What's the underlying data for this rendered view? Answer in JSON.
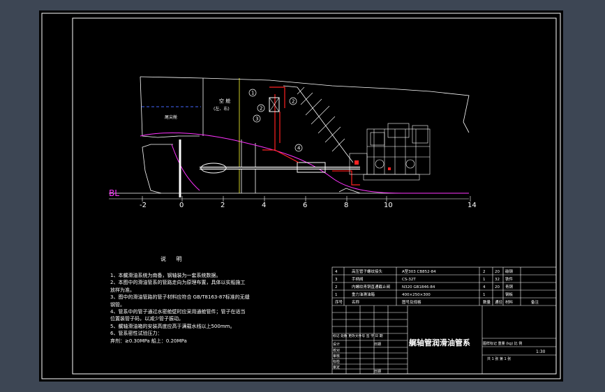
{
  "drawing": {
    "bl_label": "BL",
    "ruler_ticks": [
      "-2",
      "0",
      "2",
      "4",
      "6",
      "8",
      "10",
      "14"
    ],
    "compartment_label_1": "空 舱",
    "compartment_label_2": "(左、右)",
    "aft_label": "尾尖舱",
    "callouts": [
      "1",
      "2",
      "3",
      "4"
    ],
    "engine_label": "主机"
  },
  "notes": {
    "title": "说 明",
    "lines": [
      "1、本艉滑油系统为南备，钢轴装为一套系统数据。",
      "2、本图中的滑油管系的管路走向为原理布置，具体以实船施工",
      "   放样为准。",
      "3、图中的滑油管路的管子材料应符合 GB/T8163-87标准的无缝",
      "   钢管。",
      "4、管系中的管子通过水密舱壁时应采用通舱管件；管子在适当",
      "   位置装管子码，以减少管子振动。",
      "5、艉轴滑油箱的安装高度应高于满载水线以上500mm。",
      "6、管系密性试验压力：",
      "   弃剂：≥0.30MPa          船上：0.20MPa"
    ]
  },
  "parts_table": {
    "rows": [
      {
        "no": "4",
        "name": "高压管子螺纹接头",
        "code": "A型303  CB852-84",
        "qty": "2",
        "weight": "20",
        "material": "碳钢",
        "remark": ""
      },
      {
        "no": "3",
        "name": "手柄阀",
        "code": "CS-32T",
        "qty": "1",
        "weight": "32",
        "material": "铁件",
        "remark": ""
      },
      {
        "no": "2",
        "name": "内螺纹青铜直通截止阀",
        "code": "N320  GB1846-84",
        "qty": "4",
        "weight": "20",
        "material": "青铜",
        "remark": ""
      },
      {
        "no": "1",
        "name": "重力油滑油箱",
        "code": "400×250×300",
        "qty": "1",
        "weight": "",
        "material": "钢板",
        "remark": ""
      }
    ],
    "header": {
      "no": "序号",
      "name": "名称",
      "code": "图号及规格",
      "qty": "数量",
      "weight": "通径",
      "material": "材料",
      "remark": "备注"
    }
  },
  "title_block": {
    "drawing_title": "艉轴管润滑油管系",
    "revision_header": "标记 处数 更改文件号 签 字 日 期",
    "roles": [
      "设计",
      "校对",
      "审核",
      "标检",
      "审定"
    ],
    "role_extra_1": "日期",
    "role_extra_2": "日期",
    "stage_header": "图样标记 重量 (kg) 比 例",
    "scale": "1:30",
    "sheet_info": "共  1  张  第  1  张"
  }
}
